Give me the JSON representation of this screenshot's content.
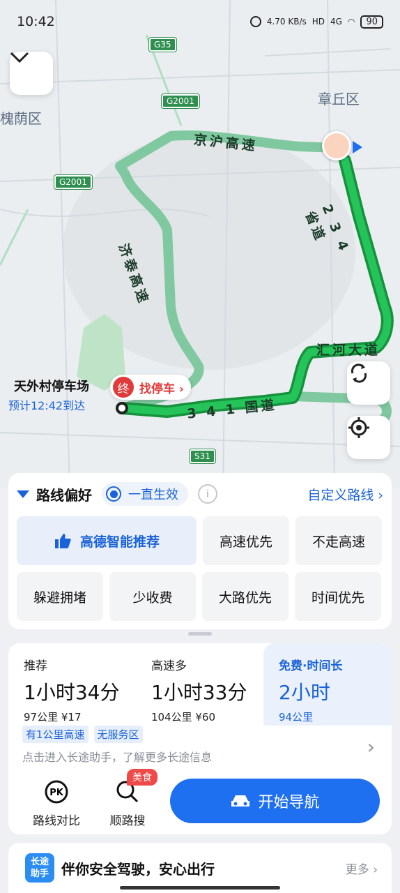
{
  "status": {
    "time": "10:42",
    "net_speed": "4.70 KB/s",
    "net_tag": "HD",
    "signal_tag": "4G",
    "battery": "90"
  },
  "map": {
    "labels": {
      "district_right": "章丘区",
      "district_left": "槐荫区"
    },
    "shields": {
      "g35": "G35",
      "g2001_top": "G2001",
      "g2001_left": "G2001",
      "s31": "S31"
    },
    "routes": {
      "jinghu": "京沪高速",
      "jitai": "济泰高速",
      "s234": "2 3 4 省道",
      "huihe": "汇河大道",
      "g341": "3 4 1 国道"
    },
    "destination": {
      "name": "天外村停车场",
      "eta": "预计12:42到达",
      "end_marker": "终",
      "find_parking": "找停车 ›"
    }
  },
  "preferences": {
    "title": "路线偏好",
    "always": "一直生效",
    "info_icon": "i",
    "custom_route": "自定义路线 ›",
    "options_row1": [
      "高德智能推荐",
      "高速优先",
      "不走高速"
    ],
    "options_row2": [
      "躲避拥堵",
      "少收费",
      "大路优先",
      "时间优先"
    ]
  },
  "routes_summary": {
    "options": [
      {
        "tag": "推荐",
        "duration": "1小时34分",
        "meta": "97公里  ¥17"
      },
      {
        "tag": "高速多",
        "duration": "1小时33分",
        "meta": "104公里  ¥60"
      },
      {
        "tag": "免费·时间长",
        "duration": "2小时",
        "meta": "94公里"
      }
    ],
    "badges": [
      "有1公里高速",
      "无服务区"
    ],
    "hint": "点击进入长途助手，了解更多长途信息",
    "compare_label": "路线对比",
    "along_label": "顺路搜",
    "food_badge": "美食",
    "start_label": "开始导航"
  },
  "assistant": {
    "logo_line1": "长途",
    "logo_line2": "助手",
    "message": "伴你安全驾驶，安心出行",
    "more": "更多 ›"
  },
  "colors": {
    "accent": "#1f6ff1",
    "route_green": "#1fae4a",
    "alt_route": "#7fc8a0",
    "danger": "#e23a3a"
  }
}
